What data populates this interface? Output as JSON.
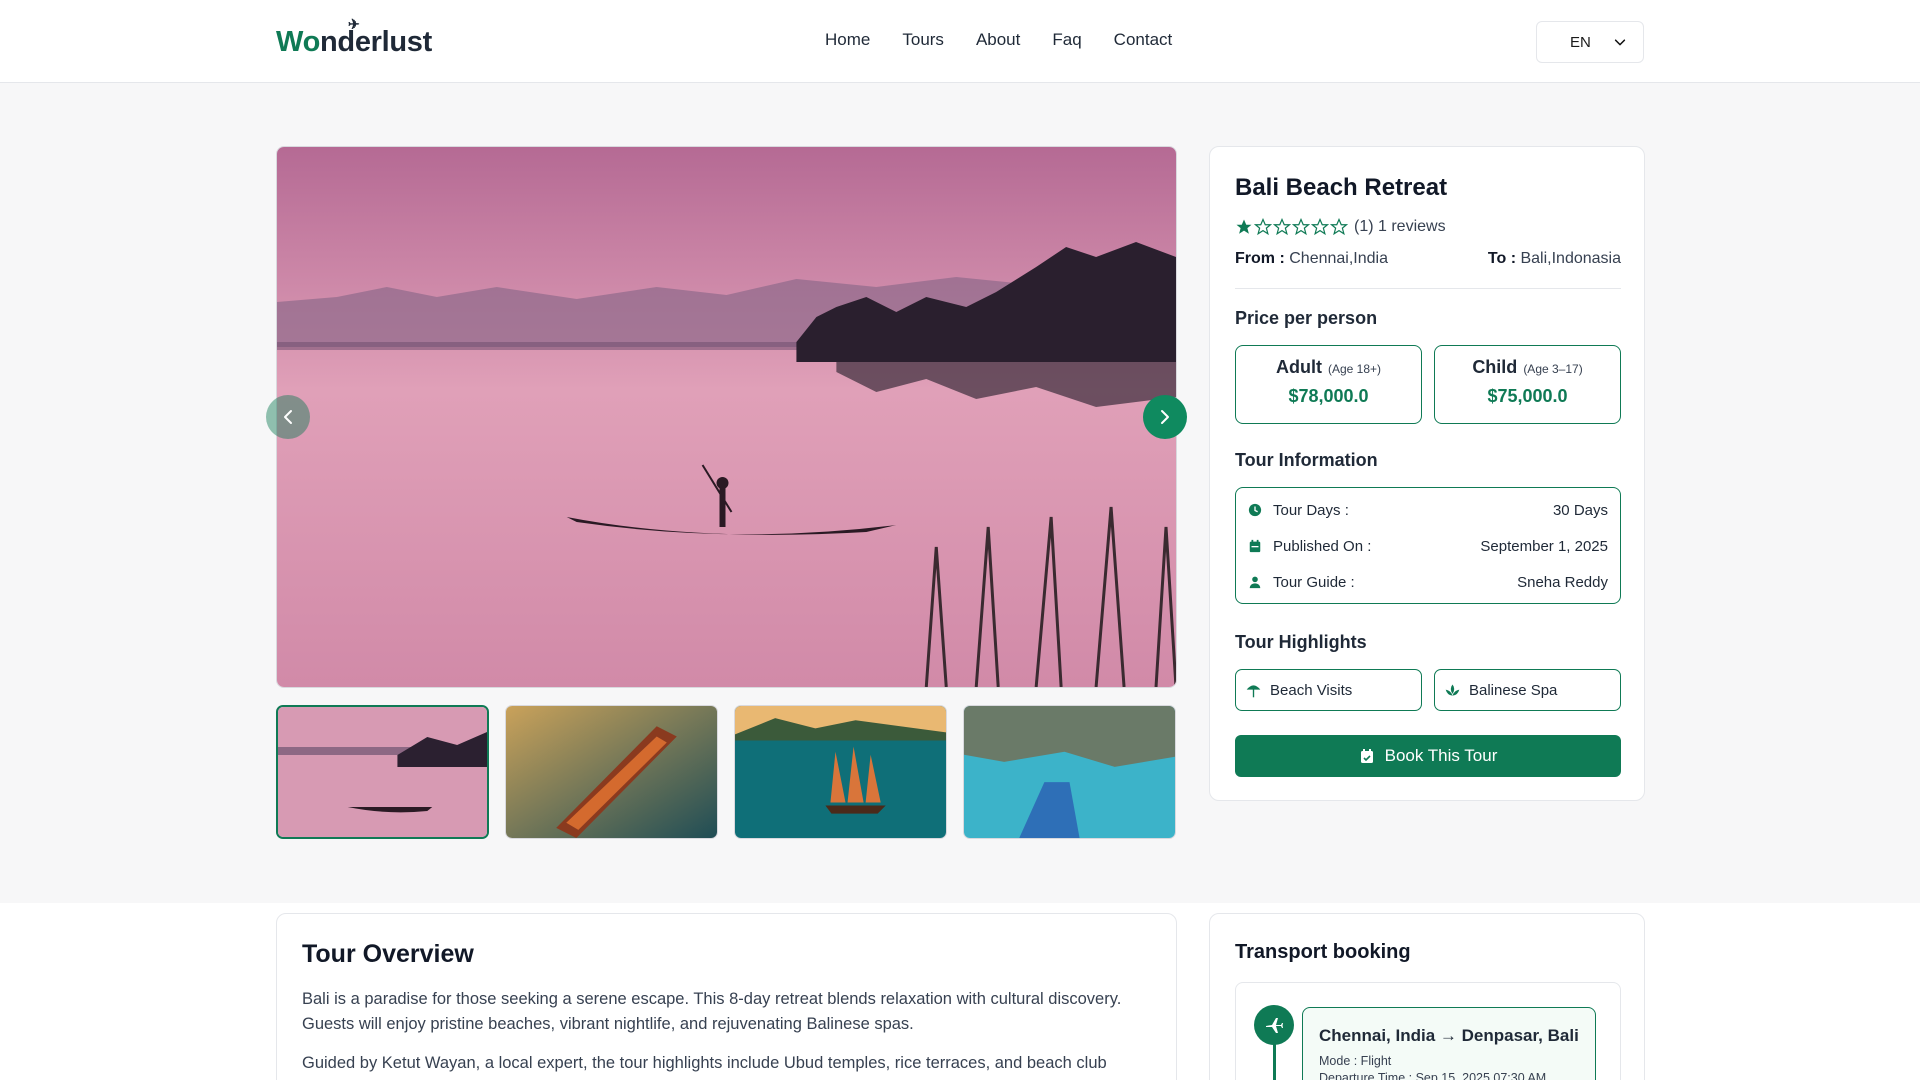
{
  "header": {
    "logo_text_first": "W",
    "logo_text_mid": "o",
    "logo_text_rest": "nderlust",
    "nav": [
      "Home",
      "Tours",
      "About",
      "Faq",
      "Contact"
    ],
    "language": "EN"
  },
  "tour": {
    "title": "Bali Beach Retreat",
    "rating_value": 1,
    "rating_max": 6,
    "rating_text": "(1) 1 reviews",
    "from_label": "From :",
    "from_value": "Chennai,India",
    "to_label": "To :",
    "to_value": "Bali,Indonasia",
    "price_heading": "Price per person",
    "prices": [
      {
        "label": "Adult",
        "age": "(Age 18+)",
        "amount": "$78,000.0"
      },
      {
        "label": "Child",
        "age": "(Age 3–17)",
        "amount": "$75,000.0"
      }
    ],
    "info_heading": "Tour Information",
    "info": [
      {
        "icon": "clock-icon",
        "label": "Tour Days :",
        "value": "30 Days"
      },
      {
        "icon": "calendar-icon",
        "label": "Published On :",
        "value": "September 1, 2025"
      },
      {
        "icon": "user-icon",
        "label": "Tour Guide :",
        "value": "Sneha Reddy"
      }
    ],
    "highlights_heading": "Tour Highlights",
    "highlights": [
      {
        "icon": "umbrella-beach-icon",
        "label": "Beach Visits"
      },
      {
        "icon": "spa-icon",
        "label": "Balinese Spa"
      }
    ],
    "book_label": "Book This Tour"
  },
  "gallery": {
    "images": [
      "sunset-lake-boat",
      "wooden-boat-water",
      "sailboat-sunset",
      "blue-boat-lagoon"
    ],
    "active_index": 0
  },
  "overview": {
    "heading": "Tour Overview",
    "paragraph_1": "Bali is a paradise for those seeking a serene escape. This 8-day retreat blends relaxation with cultural discovery. Guests will enjoy pristine beaches, vibrant nightlife, and rejuvenating Balinese spas.",
    "paragraph_2": "Guided by Ketut Wayan, a local expert, the tour highlights include Ubud temples, rice terraces, and beach club"
  },
  "transport": {
    "heading": "Transport booking",
    "route": "Chennai, India → Denpasar, Bali",
    "mode": "Mode : Flight",
    "departure": "Departure Time : Sep 15, 2025 07:30 AM"
  },
  "colors": {
    "brand": "#0f7a55",
    "star": "#0f7a55"
  }
}
